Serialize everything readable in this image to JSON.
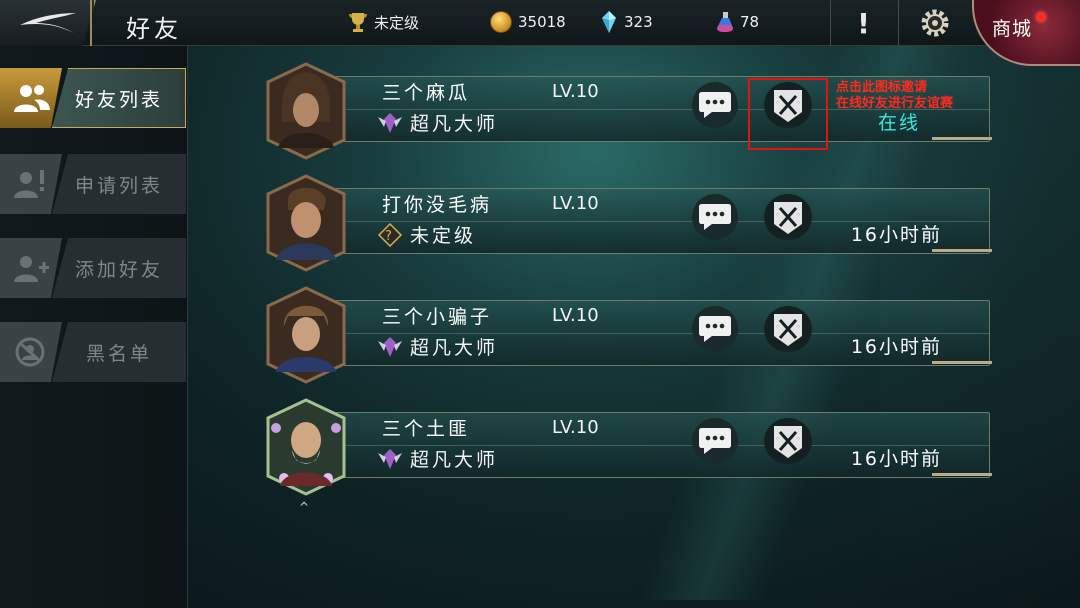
{
  "header": {
    "title": "好友",
    "rank_text": "未定级",
    "gold": "35018",
    "gems": "323",
    "potions": "78",
    "alert_symbol": "!",
    "shop_label": "商城"
  },
  "sidebar": {
    "tabs": [
      {
        "label": "好友列表",
        "icon": "friends-icon",
        "active": true
      },
      {
        "label": "申请列表",
        "icon": "friend-request-icon",
        "active": false
      },
      {
        "label": "添加好友",
        "icon": "add-friend-icon",
        "active": false
      },
      {
        "label": "黑名单",
        "icon": "blocked-icon",
        "active": false
      }
    ]
  },
  "friends": [
    {
      "name": "三个麻瓜",
      "level": "LV.10",
      "rank": "超凡大师",
      "rank_icon": "master-rank-icon",
      "status": "在线",
      "online": true
    },
    {
      "name": "打你没毛病",
      "level": "LV.10",
      "rank": "未定级",
      "rank_icon": "unranked-icon",
      "status": "16小时前",
      "online": false
    },
    {
      "name": "三个小骗子",
      "level": "LV.10",
      "rank": "超凡大师",
      "rank_icon": "master-rank-icon",
      "status": "16小时前",
      "online": false
    },
    {
      "name": "三个土匪",
      "level": "LV.10",
      "rank": "超凡大师",
      "rank_icon": "master-rank-icon",
      "status": "16小时前",
      "online": false
    }
  ],
  "annotation": {
    "line1": "点击此图标邀请",
    "line2": "在线好友进行友谊赛",
    "color": "#ff2a1e"
  },
  "colors": {
    "online": "#36e6e0",
    "accent_gold": "#c8a85a"
  }
}
